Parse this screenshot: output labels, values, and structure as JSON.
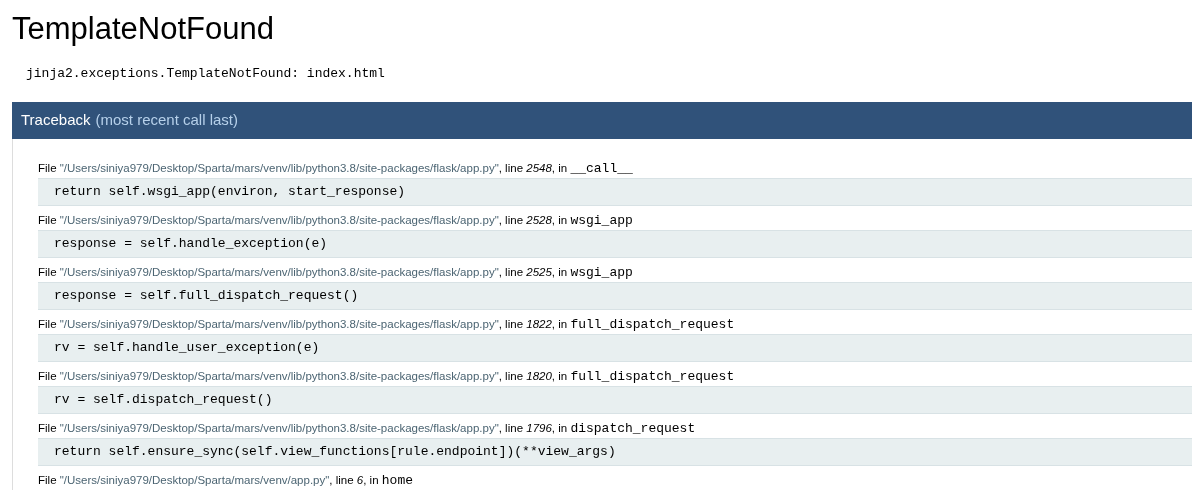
{
  "title": "TemplateNotFound",
  "exception": "jinja2.exceptions.TemplateNotFound: index.html",
  "traceback_header": {
    "title": "Traceback",
    "subtitle": "(most recent call last)"
  },
  "frames": [
    {
      "file_word": "File ",
      "path": "\"/Users/siniya979/Desktop/Sparta/mars/venv/lib/python3.8/site-packages/flask/app.py\"",
      "line_word": ", line ",
      "line": "2548",
      "in_word": ", in ",
      "function": "__call__",
      "code": "return self.wsgi_app(environ, start_response)"
    },
    {
      "file_word": "File ",
      "path": "\"/Users/siniya979/Desktop/Sparta/mars/venv/lib/python3.8/site-packages/flask/app.py\"",
      "line_word": ", line ",
      "line": "2528",
      "in_word": ", in ",
      "function": "wsgi_app",
      "code": "response = self.handle_exception(e)"
    },
    {
      "file_word": "File ",
      "path": "\"/Users/siniya979/Desktop/Sparta/mars/venv/lib/python3.8/site-packages/flask/app.py\"",
      "line_word": ", line ",
      "line": "2525",
      "in_word": ", in ",
      "function": "wsgi_app",
      "code": "response = self.full_dispatch_request()"
    },
    {
      "file_word": "File ",
      "path": "\"/Users/siniya979/Desktop/Sparta/mars/venv/lib/python3.8/site-packages/flask/app.py\"",
      "line_word": ", line ",
      "line": "1822",
      "in_word": ", in ",
      "function": "full_dispatch_request",
      "code": "rv = self.handle_user_exception(e)"
    },
    {
      "file_word": "File ",
      "path": "\"/Users/siniya979/Desktop/Sparta/mars/venv/lib/python3.8/site-packages/flask/app.py\"",
      "line_word": ", line ",
      "line": "1820",
      "in_word": ", in ",
      "function": "full_dispatch_request",
      "code": "rv = self.dispatch_request()"
    },
    {
      "file_word": "File ",
      "path": "\"/Users/siniya979/Desktop/Sparta/mars/venv/lib/python3.8/site-packages/flask/app.py\"",
      "line_word": ", line ",
      "line": "1796",
      "in_word": ", in ",
      "function": "dispatch_request",
      "code": "return self.ensure_sync(self.view_functions[rule.endpoint])(**view_args)"
    },
    {
      "file_word": "File ",
      "path": "\"/Users/siniya979/Desktop/Sparta/mars/venv/app.py\"",
      "line_word": ", line ",
      "line": "6",
      "in_word": ", in ",
      "function": "home"
    }
  ]
}
